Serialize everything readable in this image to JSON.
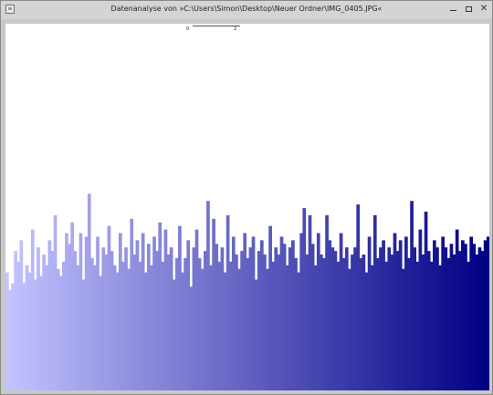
{
  "window": {
    "title": "Datenanalyse von »C:\\Users\\Simon\\Desktop\\Neuer Ordner\\IMG_0405.JPG«",
    "controls": {
      "minimize": "minimize",
      "maximize": "maximize",
      "close": "✕"
    }
  },
  "ruler": {
    "min_label": "0",
    "max_label": "2"
  },
  "colors": {
    "gradient_start": "#c3c3ff",
    "gradient_end": "#000084",
    "window_bg": "#c8c8c8",
    "plot_bg": "#ffffff"
  },
  "chart_data": {
    "type": "bar",
    "title": "",
    "ylim": [
      0,
      1
    ],
    "values": [
      0.33,
      0.28,
      0.3,
      0.39,
      0.36,
      0.42,
      0.3,
      0.35,
      0.33,
      0.45,
      0.31,
      0.4,
      0.32,
      0.38,
      0.35,
      0.42,
      0.39,
      0.49,
      0.34,
      0.32,
      0.36,
      0.44,
      0.41,
      0.47,
      0.39,
      0.35,
      0.44,
      0.31,
      0.43,
      0.55,
      0.37,
      0.35,
      0.43,
      0.32,
      0.4,
      0.38,
      0.46,
      0.39,
      0.35,
      0.33,
      0.44,
      0.36,
      0.4,
      0.34,
      0.48,
      0.38,
      0.42,
      0.36,
      0.44,
      0.33,
      0.41,
      0.35,
      0.43,
      0.39,
      0.47,
      0.36,
      0.45,
      0.38,
      0.4,
      0.31,
      0.37,
      0.46,
      0.33,
      0.37,
      0.42,
      0.29,
      0.4,
      0.45,
      0.37,
      0.34,
      0.39,
      0.53,
      0.35,
      0.48,
      0.41,
      0.36,
      0.4,
      0.33,
      0.49,
      0.36,
      0.43,
      0.38,
      0.34,
      0.39,
      0.44,
      0.37,
      0.4,
      0.43,
      0.31,
      0.39,
      0.42,
      0.38,
      0.34,
      0.46,
      0.36,
      0.4,
      0.38,
      0.43,
      0.41,
      0.35,
      0.4,
      0.42,
      0.37,
      0.33,
      0.44,
      0.51,
      0.38,
      0.49,
      0.41,
      0.35,
      0.44,
      0.38,
      0.37,
      0.49,
      0.42,
      0.4,
      0.39,
      0.36,
      0.44,
      0.37,
      0.4,
      0.34,
      0.38,
      0.4,
      0.52,
      0.37,
      0.38,
      0.33,
      0.43,
      0.35,
      0.49,
      0.37,
      0.4,
      0.42,
      0.36,
      0.4,
      0.38,
      0.44,
      0.39,
      0.42,
      0.34,
      0.43,
      0.37,
      0.53,
      0.4,
      0.36,
      0.45,
      0.38,
      0.5,
      0.39,
      0.36,
      0.42,
      0.4,
      0.35,
      0.43,
      0.4,
      0.37,
      0.41,
      0.38,
      0.45,
      0.39,
      0.42,
      0.41,
      0.36,
      0.43,
      0.41,
      0.38,
      0.4,
      0.39,
      0.42,
      0.43
    ]
  }
}
